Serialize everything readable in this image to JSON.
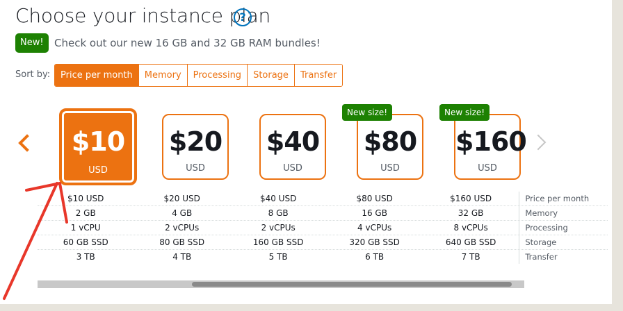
{
  "header": {
    "title": "Choose your instance plan",
    "help_glyph": "?"
  },
  "promo": {
    "badge": "New!",
    "text": "Check out our new 16 GB and 32 GB RAM bundles!"
  },
  "sort": {
    "label": "Sort by:",
    "options": [
      "Price per month",
      "Memory",
      "Processing",
      "Storage",
      "Transfer"
    ],
    "active": "Price per month"
  },
  "plans": [
    {
      "price": "$10",
      "currency": "USD",
      "selected": true
    },
    {
      "price": "$20",
      "currency": "USD"
    },
    {
      "price": "$40",
      "currency": "USD"
    },
    {
      "price": "$80",
      "currency": "USD",
      "badge": "New size!"
    },
    {
      "price": "$160",
      "currency": "USD",
      "badge": "New size!"
    }
  ],
  "specs": [
    {
      "label": "Price per month",
      "values": [
        "$10 USD",
        "$20 USD",
        "$40 USD",
        "$80 USD",
        "$160 USD"
      ]
    },
    {
      "label": "Memory",
      "values": [
        "2 GB",
        "4 GB",
        "8 GB",
        "16 GB",
        "32 GB"
      ]
    },
    {
      "label": "Processing",
      "values": [
        "1 vCPU",
        "2 vCPUs",
        "2 vCPUs",
        "4 vCPUs",
        "8 vCPUs"
      ]
    },
    {
      "label": "Storage",
      "values": [
        "60 GB SSD",
        "80 GB SSD",
        "160 GB SSD",
        "320 GB SSD",
        "640 GB SSD"
      ]
    },
    {
      "label": "Transfer",
      "values": [
        "3 TB",
        "4 TB",
        "5 TB",
        "6 TB",
        "7 TB"
      ]
    }
  ],
  "icons": {
    "prev": "chevron-left-icon",
    "next": "chevron-right-icon",
    "help": "help-icon"
  },
  "colors": {
    "accent": "#ec7211",
    "success": "#1d8102",
    "link": "#0073bb",
    "annotation": "#e8372a"
  }
}
